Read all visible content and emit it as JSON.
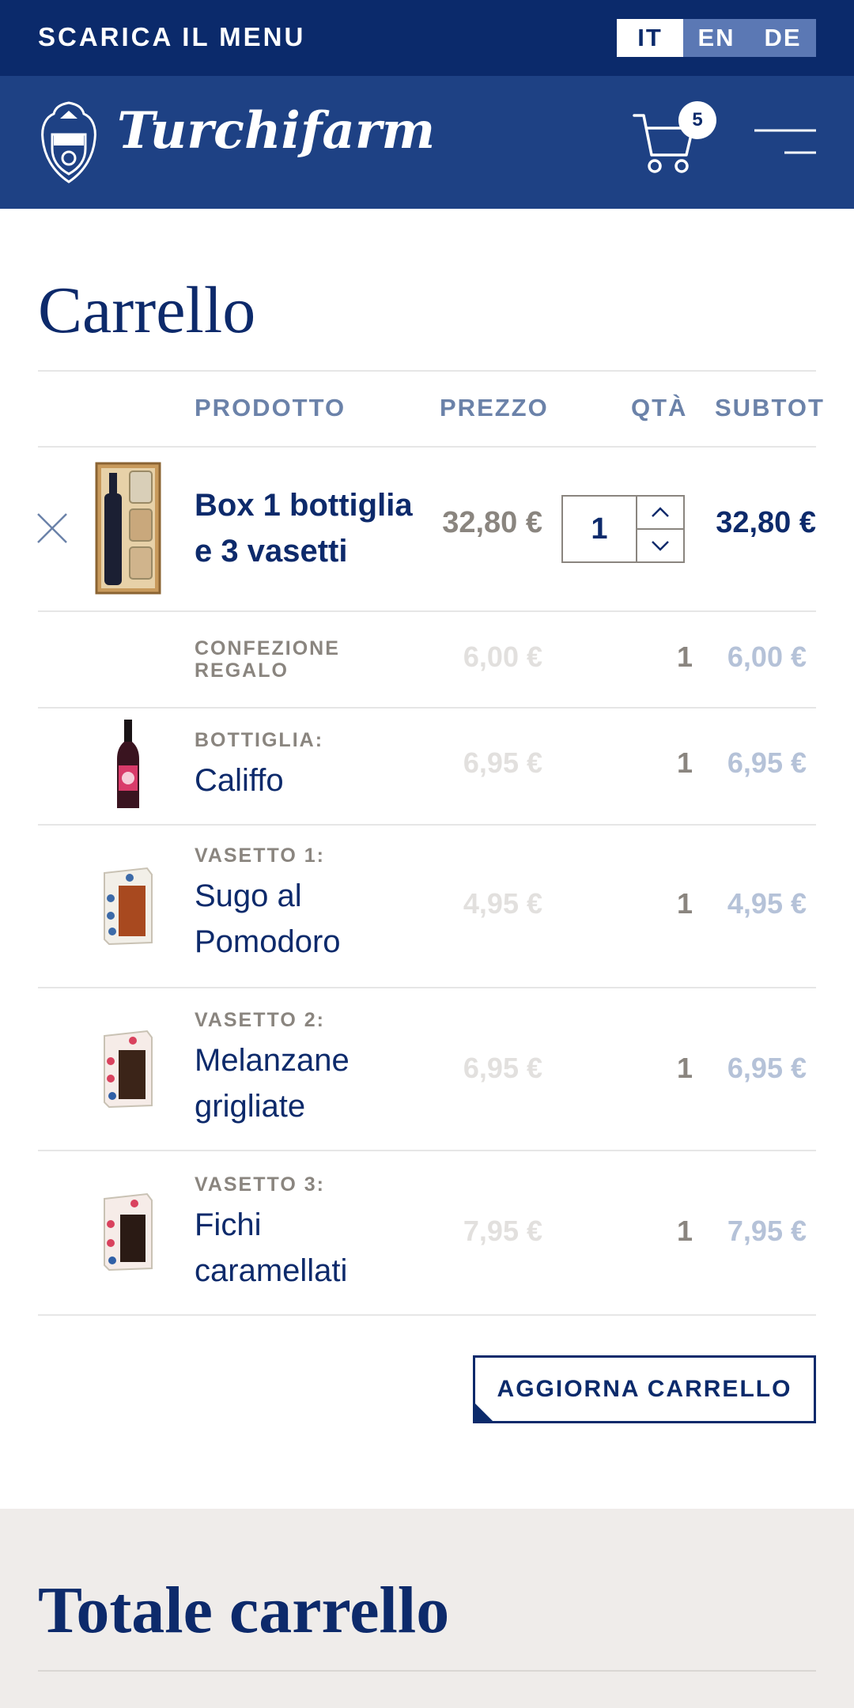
{
  "topbar": {
    "download_label": "SCARICA IL MENU",
    "languages": [
      {
        "code": "IT",
        "active": true
      },
      {
        "code": "EN",
        "active": false
      },
      {
        "code": "DE",
        "active": false
      }
    ]
  },
  "header": {
    "brand": "Turchifarm",
    "cart_count": "5",
    "icons": [
      "crest-logo-icon",
      "cart-icon",
      "hamburger-menu-icon"
    ]
  },
  "cart": {
    "title": "Carrello",
    "columns": {
      "product": "PRODOTTO",
      "price": "PREZZO",
      "qty": "QTÀ",
      "subtotal": "SUBTOT"
    },
    "main_item": {
      "name_line1": "Box 1 bottiglia",
      "name_line2": "e 3 vasetti",
      "price": "32,80 €",
      "qty": "1",
      "subtotal": "32,80 €"
    },
    "components": [
      {
        "label_line1": "CONFEZIONE",
        "label_line2": "REGALO",
        "name_line1": "",
        "name_line2": "",
        "price": "6,00 €",
        "qty": "1",
        "subtotal": "6,00 €"
      },
      {
        "label_line1": "BOTTIGLIA:",
        "label_line2": "",
        "name_line1": "Califfo",
        "name_line2": "",
        "price": "6,95 €",
        "qty": "1",
        "subtotal": "6,95 €"
      },
      {
        "label_line1": "VASETTO 1:",
        "label_line2": "",
        "name_line1": "Sugo al",
        "name_line2": "Pomodoro",
        "price": "4,95 €",
        "qty": "1",
        "subtotal": "4,95 €"
      },
      {
        "label_line1": "VASETTO 2:",
        "label_line2": "",
        "name_line1": "Melanzane",
        "name_line2": "grigliate",
        "price": "6,95 €",
        "qty": "1",
        "subtotal": "6,95 €"
      },
      {
        "label_line1": "VASETTO 3:",
        "label_line2": "",
        "name_line1": "Fichi",
        "name_line2": "caramellati",
        "price": "7,95 €",
        "qty": "1",
        "subtotal": "7,95 €"
      }
    ],
    "update_button": "AGGIORNA CARRELLO"
  },
  "totals": {
    "title": "Totale carrello"
  },
  "colors": {
    "navy": "#0b2a6b",
    "header_blue": "#1e4184",
    "lang_inactive": "#5b78b4",
    "muted_gray": "#8a857f",
    "faded_blue": "#b5c2d8",
    "totals_bg": "#efecea"
  }
}
